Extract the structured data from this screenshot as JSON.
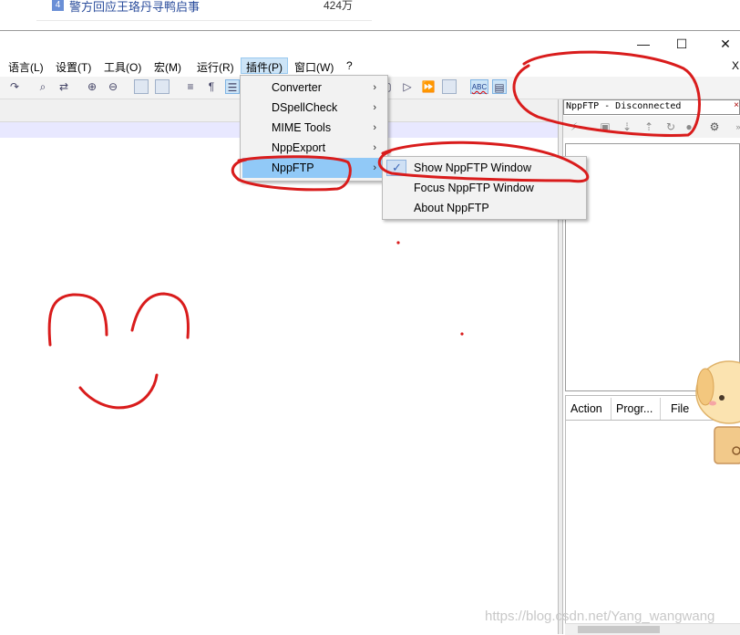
{
  "web_strip": {
    "rank": "4",
    "title": "警方回应王珞丹寻鸭启事",
    "count": "424万"
  },
  "window": {
    "minimize": "—",
    "maximize": "☐",
    "close": "✕",
    "close_small": "X"
  },
  "menubar": [
    {
      "label": "语言(L)"
    },
    {
      "label": "设置(T)"
    },
    {
      "label": "工具(O)"
    },
    {
      "label": "宏(M)"
    },
    {
      "label": "运行(R)"
    },
    {
      "label": "插件(P)",
      "active": true
    },
    {
      "label": "窗口(W)"
    },
    {
      "label": "?"
    }
  ],
  "plugins_menu": {
    "items": [
      {
        "label": "Converter",
        "arrow": "›"
      },
      {
        "label": "DSpellCheck",
        "arrow": "›"
      },
      {
        "label": "MIME Tools",
        "arrow": "›"
      },
      {
        "label": "NppExport",
        "arrow": "›"
      },
      {
        "label": "NppFTP",
        "arrow": "›",
        "highlighted": true
      }
    ]
  },
  "nppftp_submenu": {
    "items": [
      {
        "label": "Show NppFTP Window",
        "checked": true,
        "check": "✓"
      },
      {
        "label": "Focus NppFTP Window"
      },
      {
        "label": "About NppFTP"
      }
    ]
  },
  "ftp_panel": {
    "title": "NppFTP - Disconnected",
    "close": "×",
    "queue_columns": [
      "Action",
      "Progr...",
      "File"
    ]
  },
  "toolbar": {
    "spell_check_label": "ABC",
    "pilcrow": "¶"
  },
  "watermark": "https://blog.csdn.net/Yang_wangwang",
  "colors": {
    "annotation": "#d91c1c",
    "menu_highlight": "#91c9f7",
    "selection_row": "#e8e8ff"
  }
}
